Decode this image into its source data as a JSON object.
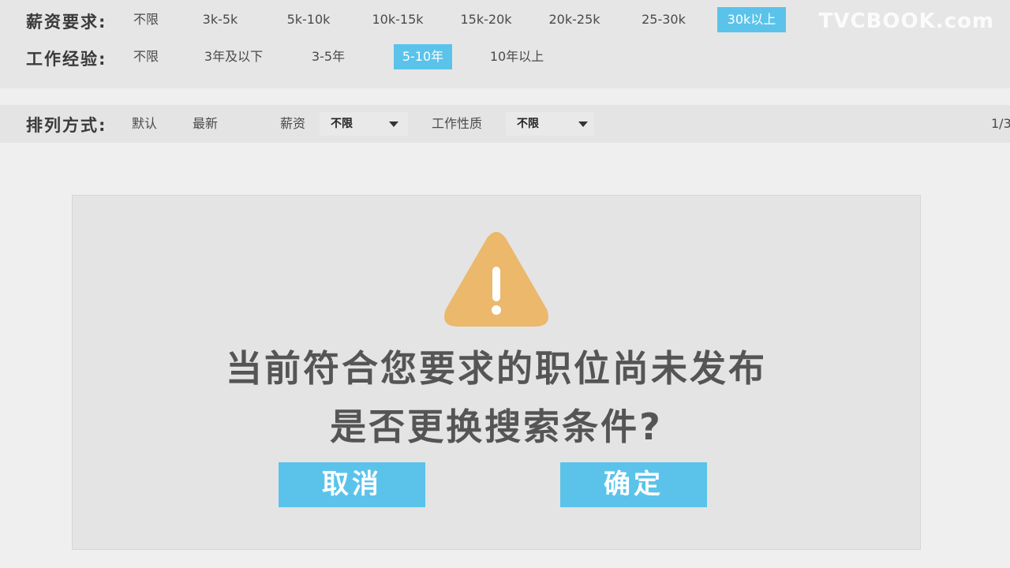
{
  "watermark": "TVCBOOK.com",
  "filters": {
    "salary": {
      "label": "薪资要求:",
      "options": [
        "不限",
        "3k-5k",
        "5k-10k",
        "10k-15k",
        "15k-20k",
        "20k-25k",
        "25-30k",
        "30k以上"
      ],
      "selected": "30k以上"
    },
    "experience": {
      "label": "工作经验:",
      "options": [
        "不限",
        "3年及以下",
        "3-5年",
        "5-10年",
        "10年以上"
      ],
      "selected": "5-10年"
    }
  },
  "sort_bar": {
    "label": "排列方式:",
    "default": "默认",
    "latest": "最新",
    "salary_label": "薪资",
    "salary_value": "不限",
    "job_type_label": "工作性质",
    "job_type_value": "不限",
    "pager": "1/3"
  },
  "dialog": {
    "icon": "warning-icon",
    "message_line1": "当前符合您要求的职位尚未发布",
    "message_line2": "是否更换搜索条件?",
    "cancel_label": "取消",
    "confirm_label": "确定",
    "icon_color": "#ebb86c",
    "button_color": "#5bc3ea"
  }
}
